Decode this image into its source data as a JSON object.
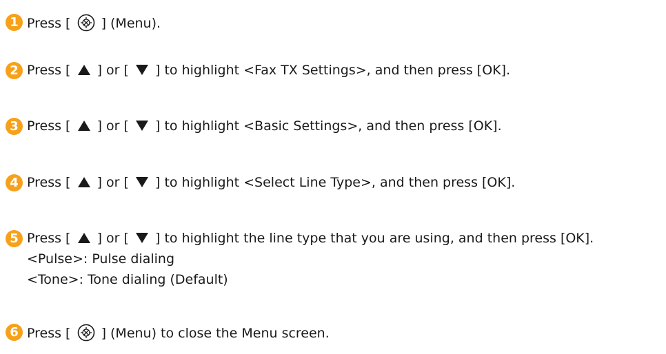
{
  "steps": [
    {
      "number": "1",
      "color": "#f7a11a",
      "before": "Press [",
      "after": "] (Menu)."
    },
    {
      "number": "2",
      "color": "#f7a11a",
      "before": "Press [",
      "middle": "] or [",
      "after": "] to highlight <Fax TX Settings>, and then press [OK]."
    },
    {
      "number": "3",
      "color": "#f7a11a",
      "before": "Press [",
      "middle": "] or [",
      "after": "] to highlight <Basic Settings>, and then press [OK]."
    },
    {
      "number": "4",
      "color": "#f7a11a",
      "before": "Press [",
      "middle": "] or [",
      "after": "] to highlight <Select Line Type>, and then press [OK]."
    },
    {
      "number": "5",
      "color": "#f7a11a",
      "before": "Press [",
      "middle": "] or [",
      "after": "] to highlight the line type that you are using, and then press [OK].",
      "sub_lines": [
        "<Pulse>: Pulse dialing",
        "<Tone>: Tone dialing (Default)"
      ]
    },
    {
      "number": "6",
      "color": "#f7a11a",
      "before": "Press [",
      "after": "] (Menu) to close the Menu screen."
    }
  ],
  "icons": {
    "menu": "menu-key-icon",
    "up": "up-arrow-icon",
    "down": "down-arrow-icon"
  },
  "colors": {
    "step_badge": "#f7a11a",
    "text": "#1a1a1a"
  }
}
